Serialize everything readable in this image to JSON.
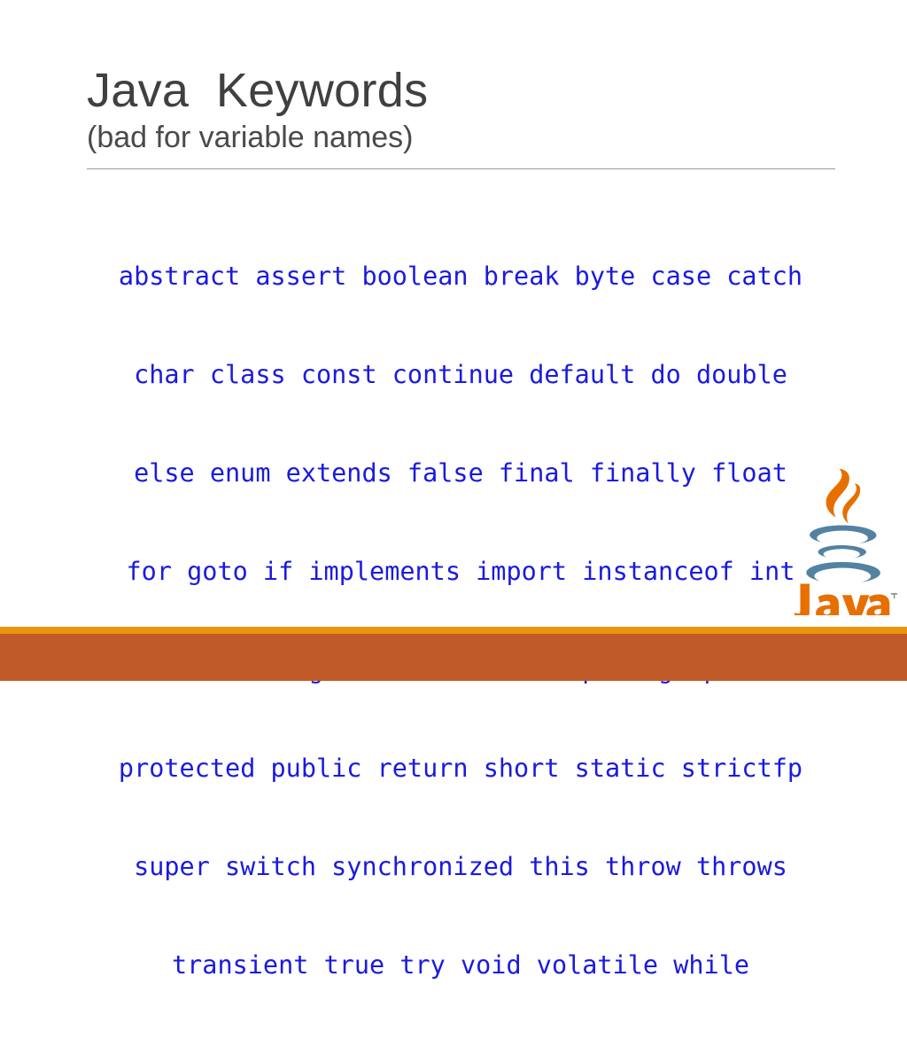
{
  "slide": {
    "title": "Java  Keywords",
    "subtitle": "(bad for variable names)",
    "keyword_lines": [
      "abstract assert boolean break byte case catch",
      "char class const continue default do double",
      "else enum extends false final finally float",
      "for goto if implements import instanceof int",
      "interface long native new null package private",
      "protected public return short static strictfp",
      "super switch synchronized this throw throws",
      "transient true try void volatile while"
    ],
    "keywords": [
      "abstract",
      "assert",
      "boolean",
      "break",
      "byte",
      "case",
      "catch",
      "char",
      "class",
      "const",
      "continue",
      "default",
      "do",
      "double",
      "else",
      "enum",
      "extends",
      "false",
      "final",
      "finally",
      "float",
      "for",
      "goto",
      "if",
      "implements",
      "import",
      "instanceof",
      "int",
      "interface",
      "long",
      "native",
      "new",
      "null",
      "package",
      "private",
      "protected",
      "public",
      "return",
      "short",
      "static",
      "strictfp",
      "super",
      "switch",
      "synchronized",
      "this",
      "throw",
      "throws",
      "transient",
      "true",
      "try",
      "void",
      "volatile",
      "while"
    ],
    "logo": {
      "name": "java-logo",
      "wordmark": "Java",
      "trademark": "™"
    },
    "colors": {
      "title_text": "#404040",
      "subtitle_text": "#4a4a4a",
      "keyword_text": "#1a1ae0",
      "rule": "#9b9b9b",
      "logo_steam": "#e76f00",
      "logo_cup": "#5382a1",
      "logo_wordmark": "#e76f00",
      "bar_amber": "#e8950c",
      "bar_terracotta": "#c05a28",
      "background": "#ffffff"
    }
  }
}
